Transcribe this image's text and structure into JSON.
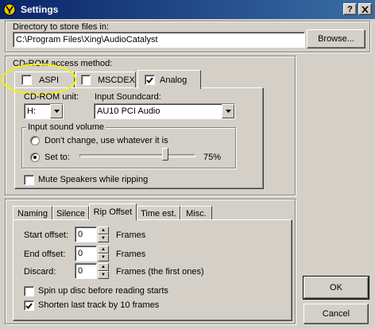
{
  "window": {
    "title": "Settings",
    "help_label": "?",
    "close_label": "X"
  },
  "directory": {
    "group_label": "Directory to store files in:",
    "path_value": "C:\\Program Files\\Xing\\AudioCatalyst",
    "browse_label": "Browse..."
  },
  "cdrom": {
    "group_label": "CD-ROM access method:",
    "tabs": [
      {
        "label": "ASPI",
        "checked": false
      },
      {
        "label": "MSCDEX",
        "checked": false
      },
      {
        "label": "Analog",
        "checked": true
      }
    ],
    "unit_label": "CD-ROM unit:",
    "unit_value": "H:",
    "soundcard_label": "Input Soundcard:",
    "soundcard_value": "AU10 PCI Audio",
    "volume_group_label": "Input sound volume",
    "radio_dont_change": "Don't change, use whatever it is",
    "radio_set_to": "Set to:",
    "volume_percent": "75%",
    "volume_level": 0.75,
    "mute_label": "Mute Speakers while ripping"
  },
  "rip": {
    "tabs": [
      "Naming",
      "Silence",
      "Rip Offset",
      "Time est.",
      "Misc."
    ],
    "active_tab": "Rip Offset",
    "start_label": "Start offset:",
    "start_value": "0",
    "start_unit": "Frames",
    "end_label": "End offset:",
    "end_value": "0",
    "end_unit": "Frames",
    "discard_label": "Discard:",
    "discard_value": "0",
    "discard_unit": "Frames (the first ones)",
    "spinup_label": "Spin up disc before reading starts",
    "shorten_label": "Shorten last track by 10 frames"
  },
  "buttons": {
    "ok_label": "OK",
    "cancel_label": "Cancel"
  },
  "colors": {
    "titlebar_start": "#0a246a",
    "titlebar_end": "#3a6ea5",
    "highlight_circle": "#f5f000"
  }
}
